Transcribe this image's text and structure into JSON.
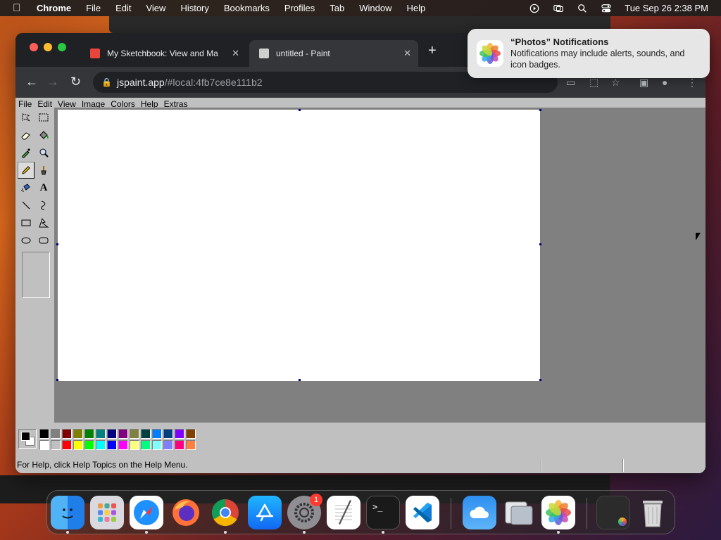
{
  "menubar": {
    "app": "Chrome",
    "items": [
      "File",
      "Edit",
      "View",
      "History",
      "Bookmarks",
      "Profiles",
      "Tab",
      "Window",
      "Help"
    ],
    "datetime": "Tue Sep 26  2:38 PM"
  },
  "browser": {
    "tabs": [
      {
        "label": "My Sketchbook: View and Ma",
        "active": false
      },
      {
        "label": "untitled - Paint",
        "active": true
      }
    ],
    "url_host": "jspaint.app",
    "url_path": "/#local:4fb7ce8e111b2"
  },
  "paint": {
    "menu": [
      "File",
      "Edit",
      "View",
      "Image",
      "Colors",
      "Help",
      "Extras"
    ],
    "tools": [
      "free-form-select",
      "rect-select",
      "eraser",
      "fill",
      "pick-color",
      "magnifier",
      "pencil",
      "brush",
      "airbrush",
      "text",
      "line",
      "curve",
      "rectangle",
      "polygon",
      "ellipse",
      "rounded-rectangle"
    ],
    "active_tool": "pencil",
    "colors": {
      "foreground": "#000000",
      "background": "#ffffff",
      "top_row": [
        "#000000",
        "#808080",
        "#800000",
        "#808000",
        "#008000",
        "#008080",
        "#000080",
        "#800080",
        "#808040",
        "#004040",
        "#0080ff",
        "#004080",
        "#8000ff",
        "#804000"
      ],
      "bottom_row": [
        "#ffffff",
        "#c0c0c0",
        "#ff0000",
        "#ffff00",
        "#00ff00",
        "#00ffff",
        "#0000ff",
        "#ff00ff",
        "#ffff80",
        "#00ff80",
        "#80ffff",
        "#8080ff",
        "#ff0080",
        "#ff8040"
      ]
    },
    "status": "For Help, click Help Topics on the Help Menu."
  },
  "notification": {
    "title": "“Photos” Notifications",
    "body": "Notifications may include alerts, sounds, and icon badges."
  },
  "dock": {
    "apps": [
      "Finder",
      "Launchpad",
      "Safari",
      "Firefox",
      "Chrome",
      "App Store",
      "System Settings",
      "TextEdit",
      "Terminal",
      "VS Code",
      "Weather",
      "Preview",
      "Photos",
      "Screenshot",
      "Trash"
    ],
    "settings_badge": "1"
  }
}
